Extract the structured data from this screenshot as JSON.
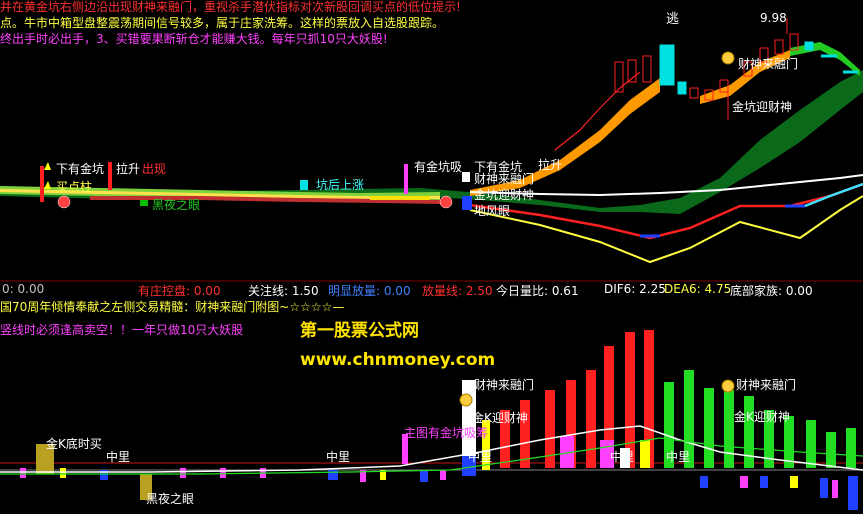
{
  "top_notes": {
    "line1": "并在黄金坑右侧边沿出现财神来融门，重视杀手潜伏指标对次新股回调买点的低位提示!",
    "line2": "点。牛市中箱型盘整震荡期间信号较多，属于庄家洗筹。这样的票放入自选股跟踪。",
    "line3": "终出手时必出手，3、买错要果断斩仓才能赚大钱。每年只抓10只大妖股!"
  },
  "price_labels": {
    "escape": "逃",
    "high_price": "9.98",
    "caishen_top": "财神来融门",
    "jinkeng_top": "金坑迎财神",
    "xia_jinkeng_left": "下有金坑",
    "lasheng_left": "拉升",
    "chuxian_left": "出现",
    "maidian": "买点柱",
    "heiye_top": "黑夜之眼",
    "kenghou": "坑后上涨",
    "you_jinkeng": "有金坑吸",
    "xia_jinkeng_mid": "下有金坑",
    "lasheng_mid": "拉升",
    "caishen_mid": "财神来融门",
    "jinkeng_mid": "金坑迎财神",
    "dingtian": "地风眼"
  },
  "indicator_bar": {
    "item0": "0: 0.00",
    "youzhuang": "有庄控盘: 0.00",
    "guanzhu": "关注线: 1.50",
    "mingxian": "明显放量: 0.00",
    "fangliang": "放量线: 2.50",
    "liangbi": "今日量比: 0.61",
    "dif": "DIF6: 2.25",
    "dea": "DEA6: 4.75",
    "dibu": "底部家族: 0.00"
  },
  "lower_notes": {
    "line1": "国70周年倾情奉献之左侧交易精髓：财神来融门附图~☆☆☆☆—",
    "line2": "竖线时必须逢高卖空！！一年只做10只大妖股"
  },
  "watermark": {
    "name": "第一股票公式网",
    "url": "www.chnmoney.com"
  },
  "lower_labels": {
    "jinK_dishi": "金K底时买",
    "zhongli1": "中里",
    "zhongli2": "中里",
    "zhongli3": "中里",
    "zhongli4": "中里",
    "zhongli5": "中里",
    "zhutu": "主图有金坑吸筹",
    "caishen1": "财神来融门",
    "caishen2": "财神来融门",
    "jinK1": "金K迎财神",
    "jinK2": "金K迎财神",
    "heiye": "黑夜之眼"
  },
  "colors": {
    "red": "#ff2020",
    "yellow": "#ffff00",
    "green": "#00e000",
    "cyan": "#00e0e0",
    "magenta": "#ff40ff",
    "white": "#ffffff",
    "orange": "#ff9900",
    "darkgreen": "#0a7a20"
  }
}
